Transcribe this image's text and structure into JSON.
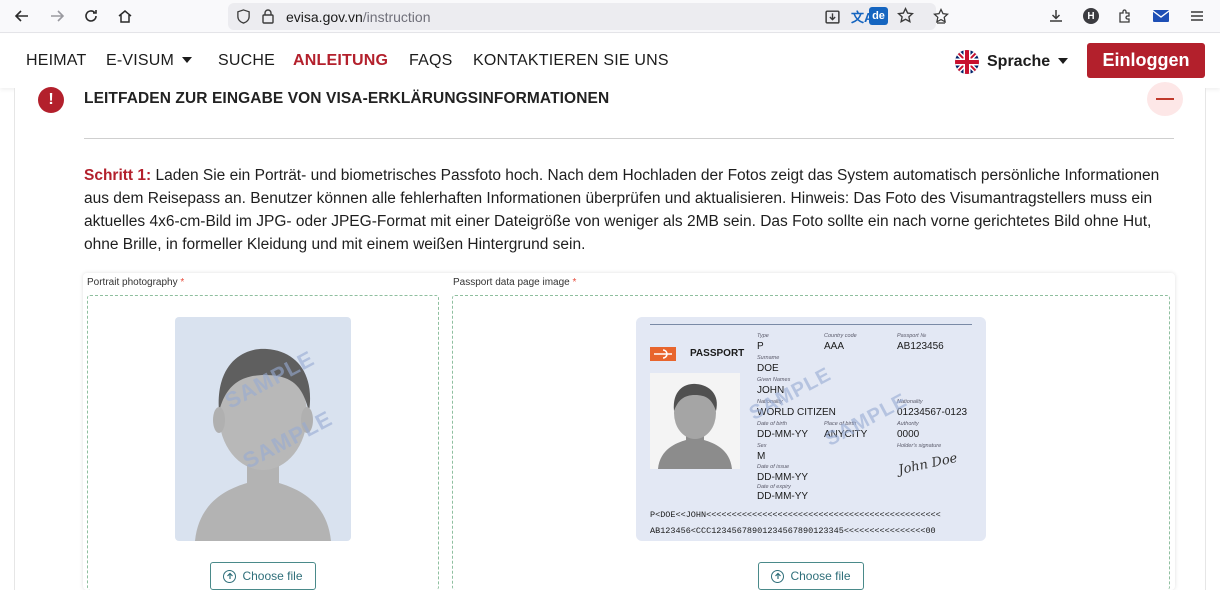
{
  "browser": {
    "url_host": "evisa.gov.vn",
    "url_path": "/instruction",
    "translate_badge": "de",
    "profile_initial": "H"
  },
  "nav": {
    "items": [
      {
        "label": "HEIMAT",
        "active": false,
        "dropdown": false
      },
      {
        "label": "E-VISUM",
        "active": false,
        "dropdown": true
      },
      {
        "label": "SUCHE",
        "active": false,
        "dropdown": false
      },
      {
        "label": "ANLEITUNG",
        "active": true,
        "dropdown": false
      },
      {
        "label": "FAQS",
        "active": false,
        "dropdown": false
      },
      {
        "label": "KONTAKTIEREN SIE UNS",
        "active": false,
        "dropdown": false
      }
    ],
    "language_label": "Sprache",
    "login_label": "Einloggen"
  },
  "section": {
    "alert_symbol": "!",
    "title": "LEITFADEN ZUR EINGABE VON VISA-ERKLÄRUNGSINFORMATIONEN"
  },
  "step": {
    "label": "Schritt 1:",
    "text": " Laden Sie ein Porträt- und biometrisches Passfoto hoch. Nach dem Hochladen der Fotos zeigt das System automatisch persönliche Informationen aus dem Reisepass an. Benutzer können alle fehlerhaften Informationen überprüfen und aktualisieren. Hinweis: Das Foto des Visumantragstellers muss ein aktuelles 4x6-cm-Bild im JPG- oder JPEG-Format mit einer Dateigröße von weniger als 2MB sein. Das Foto sollte ein nach vorne gerichtetes Bild ohne Hut, ohne Brille, in formeller Kleidung und mit einem weißen Hintergrund sein."
  },
  "upload": {
    "portrait_label": "Portrait photography",
    "passport_label": "Passport data page image",
    "required_mark": "*",
    "choose_file": "Choose file",
    "watermark": "SAMPLE"
  },
  "passport": {
    "heading": "PASSPORT",
    "type_label": "Type",
    "type": "P",
    "country_label": "Country code",
    "country": "AAA",
    "number_label": "Passport №",
    "number": "AB123456",
    "surname_label": "Surname",
    "surname": "DOE",
    "given_label": "Given Names",
    "given": "JOHN",
    "nationality_label": "Nationality",
    "nationality": "WORLD CITIZEN",
    "personal_label": "Nationality",
    "personal": "01234567-0123",
    "dob_label": "Date of birth",
    "dob": "DD-MM-YY",
    "pob_label": "Place of birth",
    "pob": "ANYCITY",
    "authority_label": "Authority",
    "authority": "0000",
    "sex_label": "Sex",
    "sex": "M",
    "holder_sig_label": "Holder's signature",
    "issue_label": "Date of issue",
    "issue": "DD-MM-YY",
    "expiry_label": "Date of expiry",
    "expiry": "DD-MM-YY",
    "signature": "John Doe",
    "mrz1": "P<DOE<<JOHN<<<<<<<<<<<<<<<<<<<<<<<<<<<<<<<<<<<<<<<<<<<<<<",
    "mrz2": "AB123456<CCC12345678901234567890123345<<<<<<<<<<<<<<<<00"
  },
  "colors": {
    "brand_red": "#b3202c",
    "accent_teal": "#2f6f7a"
  }
}
